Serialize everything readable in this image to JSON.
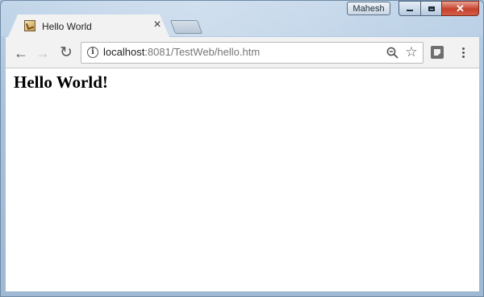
{
  "window": {
    "profile_name": "Mahesh",
    "controls": {
      "minimize": "minimize",
      "maximize": "maximize",
      "close": "close"
    }
  },
  "tab": {
    "title": "Hello World",
    "favicon": "page-favicon-icon",
    "close_glyph": "×"
  },
  "toolbar": {
    "back_glyph": "←",
    "forward_glyph": "→",
    "reload_glyph": "↻",
    "url_host": "localhost",
    "url_rest": ":8081/TestWeb/hello.htm",
    "star_glyph": "☆"
  },
  "page": {
    "heading": "Hello World!"
  },
  "colors": {
    "frame": "#a9c3dc",
    "close_button": "#c7402a",
    "toolbar": "#f2f2f2",
    "content": "#ffffff"
  }
}
